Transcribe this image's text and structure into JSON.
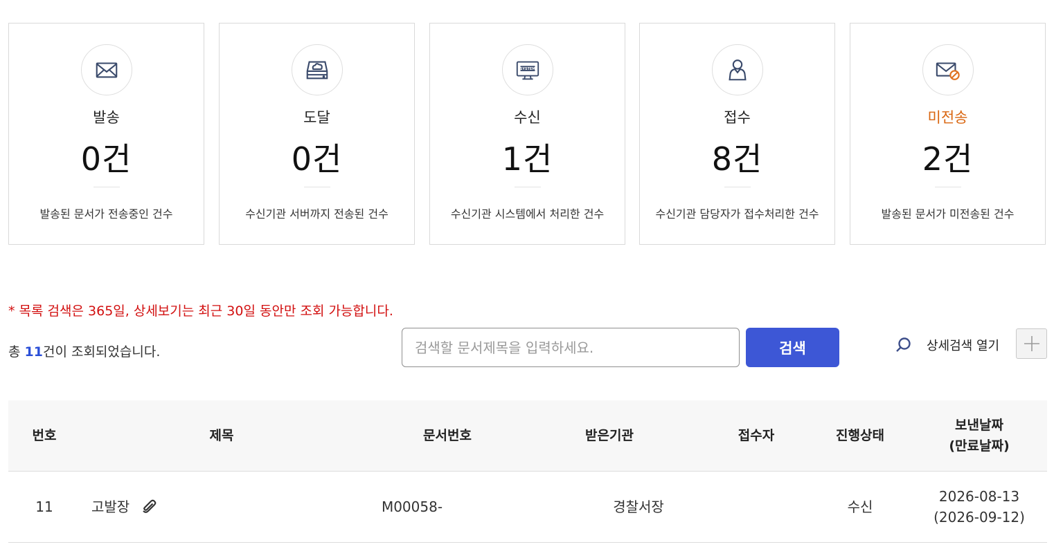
{
  "cards": [
    {
      "title": "발송",
      "count": "0건",
      "desc": "발송된 문서가 전송중인 건수",
      "icon": "envelope-icon"
    },
    {
      "title": "도달",
      "count": "0건",
      "desc": "수신기관 서버까지 전송된 건수",
      "icon": "server-cloud-icon"
    },
    {
      "title": "수신",
      "count": "1건",
      "desc": "수신기관 시스템에서 처리한 건수",
      "icon": "system-monitor-icon",
      "icon_text": "SYSTEM"
    },
    {
      "title": "접수",
      "count": "8건",
      "desc": "수신기관 담당자가 접수처리한 건수",
      "icon": "person-icon"
    },
    {
      "title": "미전송",
      "count": "2건",
      "desc": "발송된 문서가 미전송된 건수",
      "icon": "envelope-blocked-icon"
    }
  ],
  "notice": "* 목록 검색은 365일, 상세보기는 최근 30일 동안만 조회 가능합니다.",
  "total": {
    "prefix": "총 ",
    "count": "11",
    "suffix": "건이 조회되었습니다."
  },
  "search": {
    "placeholder": "검색할 문서제목을 입력하세요.",
    "button": "검색",
    "advanced_label": "상세검색 열기"
  },
  "table": {
    "headers": {
      "no": "번호",
      "title": "제목",
      "doc_no": "문서번호",
      "recipient": "받은기관",
      "receiver": "접수자",
      "status": "진행상태",
      "date_line1": "보낸날짜",
      "date_line2": "(만료날짜)"
    },
    "rows": [
      {
        "no": "11",
        "title": "고발장",
        "doc_no": "M00058-",
        "recipient": "경찰서장",
        "receiver": "",
        "status": "수신",
        "sent": "2026-08-13",
        "expire": "(2026-09-12)"
      }
    ]
  },
  "colors": {
    "accent": "#3d57d6",
    "warning": "#d9650f",
    "notice": "#d20f0f",
    "icon": "#3a4a6b"
  }
}
